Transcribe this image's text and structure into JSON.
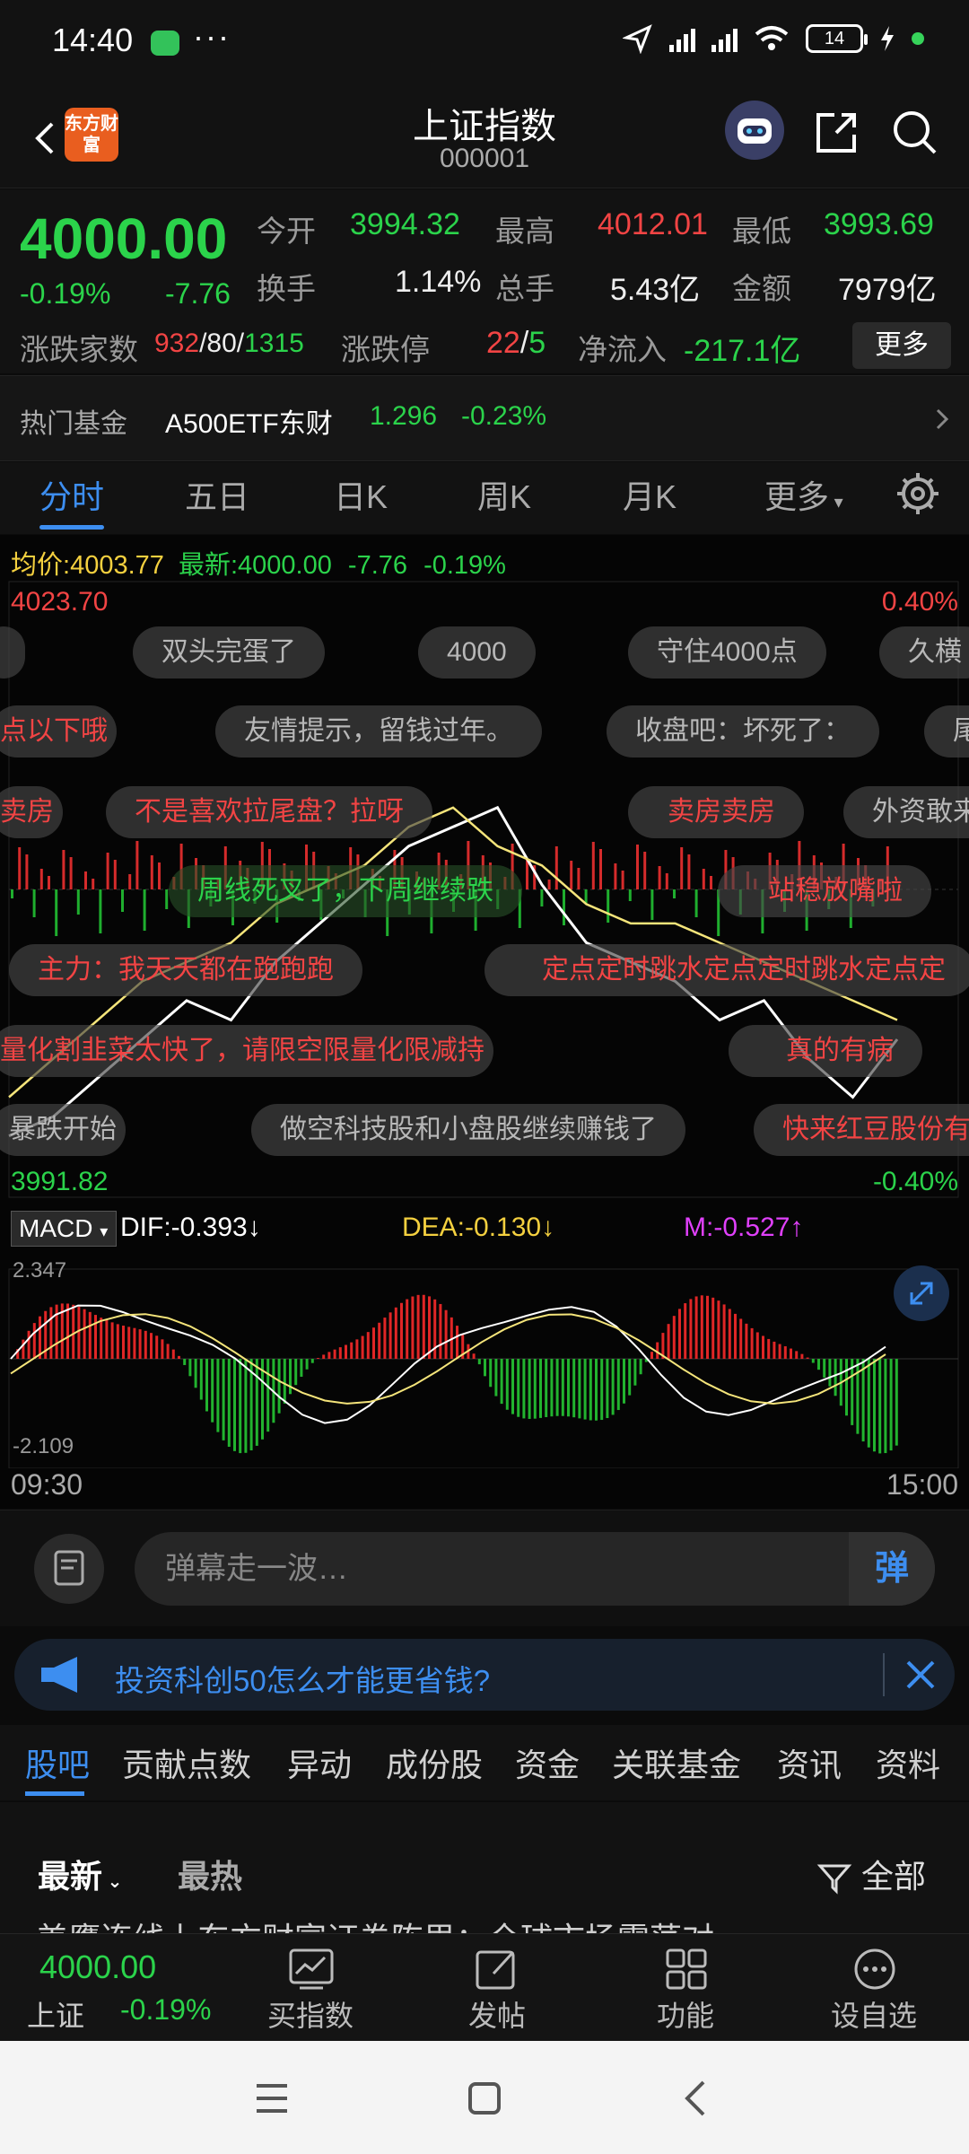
{
  "status_bar": {
    "time": "14:40",
    "battery": "14"
  },
  "header": {
    "title": "上证指数",
    "code": "000001",
    "logo_text": "东方财富"
  },
  "quote": {
    "price": "4000.00",
    "change_pct": "-0.19%",
    "change": "-7.76",
    "labels": {
      "open": "今开",
      "high": "最高",
      "low": "最低",
      "turnover": "换手",
      "volume": "总手",
      "amount": "金额",
      "advdec": "涨跌家数",
      "limit": "涨跌停",
      "inflow": "净流入"
    },
    "open": "3994.32",
    "high": "4012.01",
    "low": "3993.69",
    "turnover": "1.14%",
    "volume": "5.43亿",
    "amount": "7979亿",
    "adv": "932",
    "flat": "80",
    "dec": "1315",
    "limit_up": "22",
    "limit_down": "5",
    "inflow": "-217.1亿",
    "more_label": "更多"
  },
  "hot_fund": {
    "label": "热门基金",
    "name": "A500ETF东财",
    "price": "1.296",
    "chg": "-0.23%"
  },
  "chart_tabs": {
    "t1": "分时",
    "t2": "五日",
    "t3": "日K",
    "t4": "周K",
    "t5": "月K",
    "t6": "更多"
  },
  "chart_info": {
    "avg_label": "均价:",
    "avg_value": "4003.77",
    "latest_label": "最新:",
    "latest_value": "4000.00",
    "latest_chg": "-7.76",
    "latest_pct": "-0.19%"
  },
  "axis": {
    "y_top": "4023.70",
    "y_bottom": "3991.82",
    "pct_top": "0.40%",
    "pct_bottom": "-0.40%",
    "macd_top": "2.347",
    "macd_bottom": "-2.109",
    "time_start": "09:30",
    "time_end": "15:00"
  },
  "macd": {
    "badge": "MACD",
    "dif": "DIF:-0.393↓",
    "dea": "DEA:-0.130↓",
    "m": "M:-0.527↑"
  },
  "danmu": {
    "d1": "双头完蛋了",
    "d2": "4000",
    "d3": "守住4000点",
    "d4": "久横",
    "d5": "点以下哦",
    "d6": "友情提示，留钱过年。",
    "d7": "收盘吧：坏死了：",
    "d8": "尾",
    "d9": "卖房",
    "d10": "不是喜欢拉尾盘？拉呀",
    "d11": "卖房卖房",
    "d12": "外资敢来",
    "d13": "周线死叉了，下周继续跌",
    "d14": "站稳放嘴啦",
    "d15": "主力：我天天都在跑跑跑",
    "d16": "定点定时跳水定点定时跳水定点定",
    "d17": "量化割韭菜太快了，请限空限量化限减持",
    "d18": "真的有病",
    "d19": "暴跌开始",
    "d20": "做空科技股和小盘股继续赚钱了",
    "d21": "快来红豆股份有"
  },
  "input": {
    "placeholder": "弹幕走一波…",
    "send": "弹"
  },
  "notice": {
    "text": "投资科创50怎么才能更省钱?"
  },
  "section_tabs": {
    "t1": "股吧",
    "t2": "贡献点数",
    "t3": "异动",
    "t4": "成份股",
    "t5": "资金",
    "t6": "关联基金",
    "t7": "资讯",
    "t8": "资料"
  },
  "filters": {
    "latest": "最新",
    "hot": "最热",
    "all": "全部",
    "peek": "美鹰连线上东方财富证券陈思：全球市场震荡对"
  },
  "bottom_bar": {
    "price": "4000.00",
    "name": "上证",
    "pct": "-0.19%",
    "b1": "买指数",
    "b2": "发帖",
    "b3": "功能",
    "b4": "设自选"
  },
  "chart_data": {
    "type": "line",
    "x": [
      "09:30",
      "15:00"
    ],
    "ylim": [
      3991.82,
      4023.7
    ],
    "series": [
      {
        "name": "最新",
        "values": [
          3995,
          3996,
          3998,
          4000,
          4002,
          4001,
          4004,
          4006,
          4008,
          4010,
          4011,
          4012,
          4008,
          4005,
          4004,
          4003,
          4001,
          4002,
          3999,
          3997,
          4000
        ]
      },
      {
        "name": "均价",
        "values": [
          3997,
          3999,
          4001,
          4003,
          4004,
          4005,
          4007,
          4008,
          4009,
          4011,
          4012,
          4010,
          4009,
          4007,
          4006,
          4006,
          4005,
          4004,
          4003,
          4002,
          4001
        ]
      }
    ],
    "macd_ylim": [
      -2.109,
      2.347
    ]
  }
}
